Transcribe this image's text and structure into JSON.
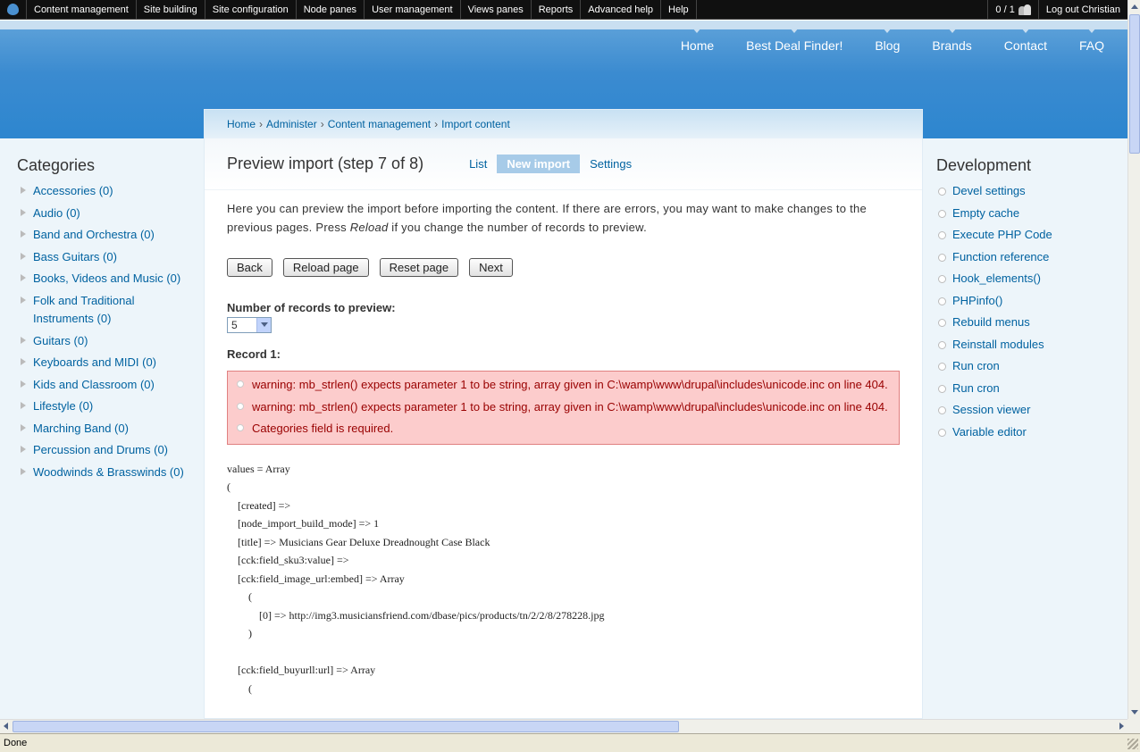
{
  "admin_menu": {
    "items": [
      "Content management",
      "Site building",
      "Site configuration",
      "Node panes",
      "User management",
      "Views panes",
      "Reports",
      "Advanced help",
      "Help"
    ],
    "user_count": "0 / 1",
    "logout": "Log out Christian"
  },
  "primary_nav": [
    "Home",
    "Best Deal Finder!",
    "Blog",
    "Brands",
    "Contact",
    "FAQ"
  ],
  "breadcrumb": [
    "Home",
    "Administer",
    "Content management",
    "Import content"
  ],
  "breadcrumb_separator": "›",
  "page": {
    "title": "Preview import (step 7 of 8)",
    "tabs": [
      "List",
      "New import",
      "Settings"
    ],
    "active_tab": "New import",
    "intro_before": "Here you can preview the import before importing the content. If there are errors, you may want to make changes to the previous pages. Press ",
    "intro_em": "Reload",
    "intro_after": " if you change the number of records to preview.",
    "buttons": {
      "back": "Back",
      "reload": "Reload page",
      "reset": "Reset page",
      "next": "Next"
    },
    "records_label": "Number of records to preview:",
    "records_value": "5",
    "record_heading": "Record 1:",
    "errors": [
      "warning: mb_strlen() expects parameter 1 to be string, array given in C:\\wamp\\www\\drupal\\includes\\unicode.inc on line 404.",
      "warning: mb_strlen() expects parameter 1 to be string, array given in C:\\wamp\\www\\drupal\\includes\\unicode.inc on line 404.",
      "Categories field is required."
    ],
    "code": "values = Array\n(\n    [created] =>\n    [node_import_build_mode] => 1\n    [title] => Musicians Gear Deluxe Dreadnought Case Black\n    [cck:field_sku3:value] =>\n    [cck:field_image_url:embed] => Array\n        (\n            [0] => http://img3.musiciansfriend.com/dbase/pics/products/tn/2/2/8/278228.jpg\n        )\n\n    [cck:field_buyurll:url] => Array\n        ("
  },
  "categories": {
    "title": "Categories",
    "items": [
      "Accessories (0)",
      "Audio (0)",
      "Band and Orchestra (0)",
      "Bass Guitars (0)",
      "Books, Videos and Music (0)",
      "Folk and Traditional Instruments (0)",
      "Guitars (0)",
      "Keyboards and MIDI (0)",
      "Kids and Classroom (0)",
      "Lifestyle (0)",
      "Marching Band (0)",
      "Percussion and Drums (0)",
      "Woodwinds & Brasswinds (0)"
    ]
  },
  "development": {
    "title": "Development",
    "items": [
      "Devel settings",
      "Empty cache",
      "Execute PHP Code",
      "Function reference",
      "Hook_elements()",
      "PHPinfo()",
      "Rebuild menus",
      "Reinstall modules",
      "Run cron",
      "Run cron",
      "Session viewer",
      "Variable editor"
    ]
  },
  "status_bar": {
    "text": "Done"
  },
  "colors": {
    "link": "#0062a0",
    "header_blue": "#2d86cf",
    "error_bg": "#fccccc",
    "error_text": "#990000"
  }
}
